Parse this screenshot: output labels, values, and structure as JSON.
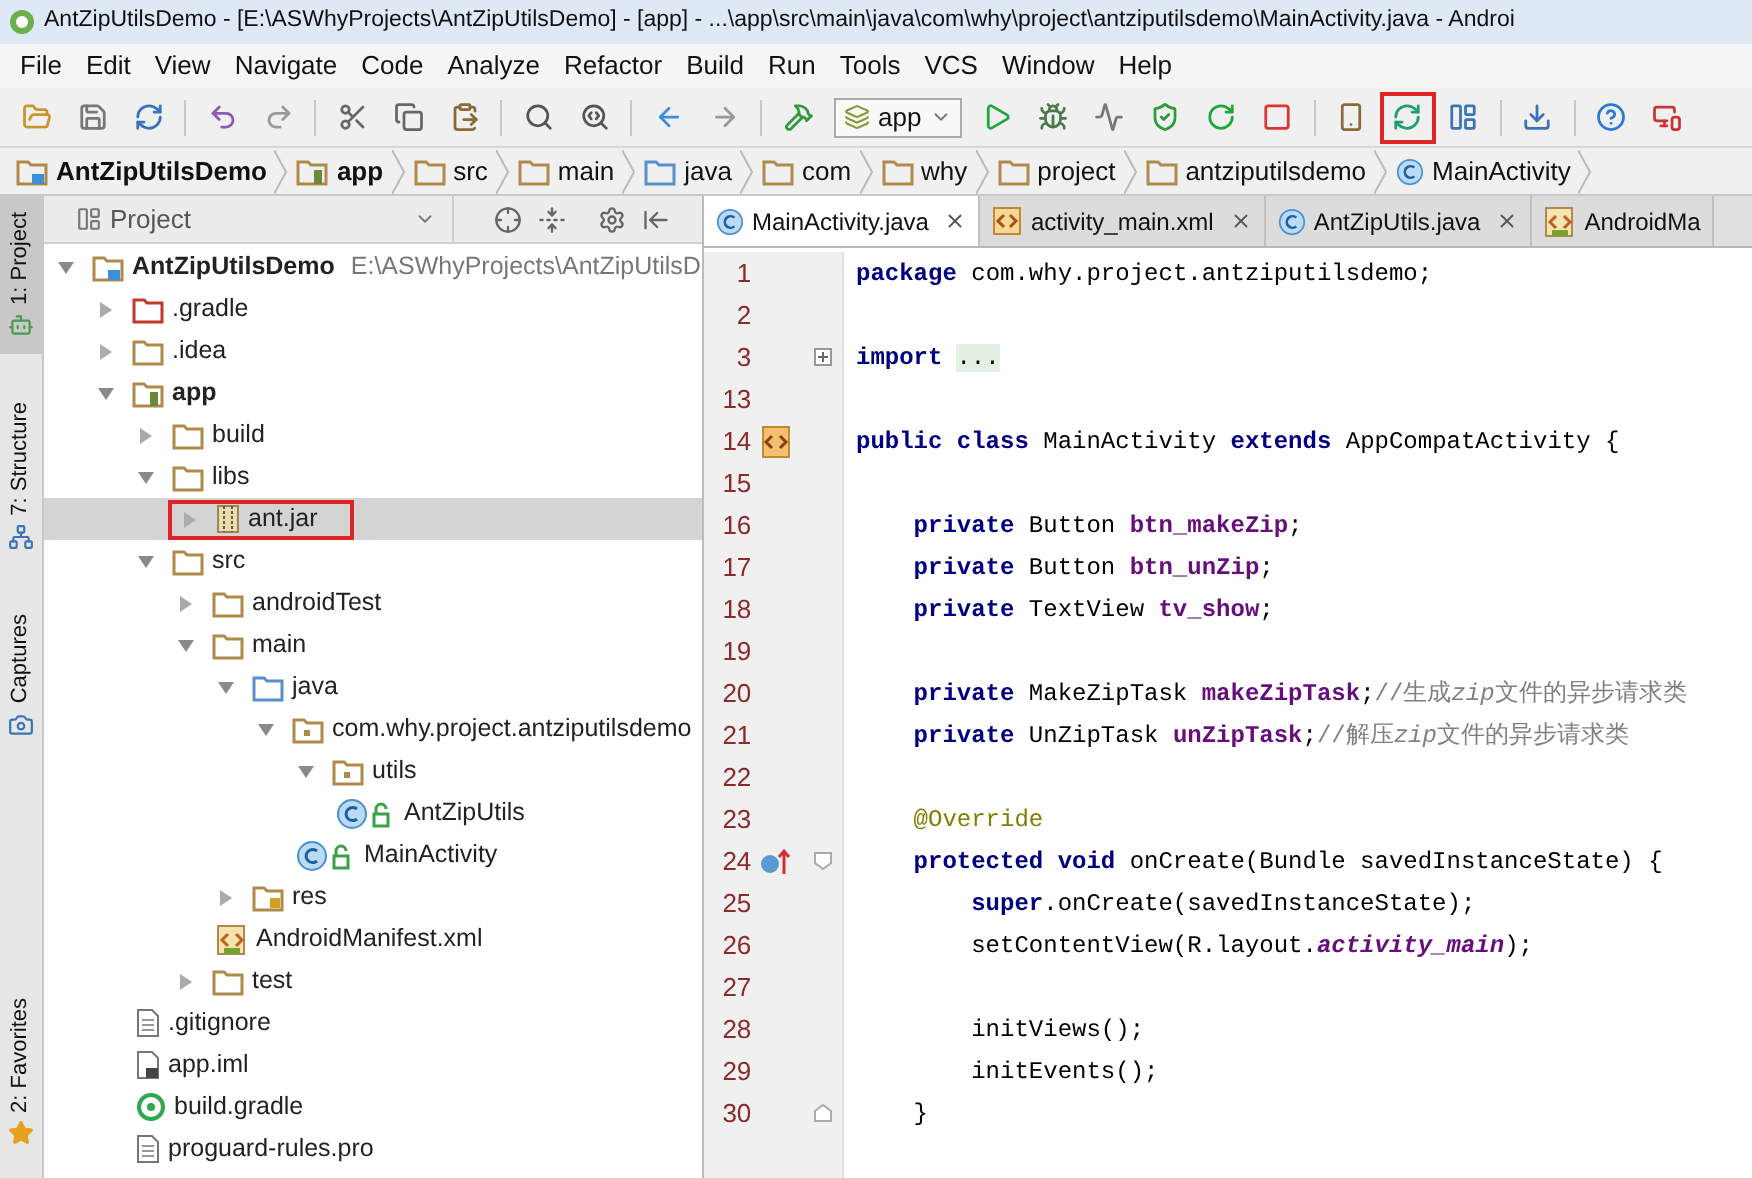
{
  "window": {
    "title": "AntZipUtilsDemo - [E:\\ASWhyProjects\\AntZipUtilsDemo] - [app] - ...\\app\\src\\main\\java\\com\\why\\project\\antziputilsdemo\\MainActivity.java - Androi"
  },
  "menu": [
    "File",
    "Edit",
    "View",
    "Navigate",
    "Code",
    "Analyze",
    "Refactor",
    "Build",
    "Run",
    "Tools",
    "VCS",
    "Window",
    "Help"
  ],
  "toolbar": [
    [
      {
        "kind": "open"
      },
      {
        "kind": "save"
      },
      {
        "kind": "sync"
      }
    ],
    [
      {
        "kind": "undo"
      },
      {
        "kind": "redo"
      }
    ],
    [
      {
        "kind": "cut"
      },
      {
        "kind": "copy"
      },
      {
        "kind": "paste"
      }
    ],
    [
      {
        "kind": "find"
      },
      {
        "kind": "replace"
      }
    ],
    [
      {
        "kind": "back"
      },
      {
        "kind": "forward"
      }
    ],
    [
      {
        "kind": "make"
      },
      {
        "kind": "config",
        "label": "app"
      },
      {
        "kind": "run"
      },
      {
        "kind": "debug"
      },
      {
        "kind": "attach"
      },
      {
        "kind": "coverage"
      },
      {
        "kind": "apply"
      },
      {
        "kind": "stop"
      }
    ],
    [
      {
        "kind": "avd"
      },
      {
        "kind": "gradle",
        "highlighted": true
      },
      {
        "kind": "structure"
      }
    ],
    [
      {
        "kind": "sdk"
      }
    ],
    [
      {
        "kind": "help"
      },
      {
        "kind": "monitor"
      }
    ]
  ],
  "breadcrumbs": [
    {
      "label": "AntZipUtilsDemo",
      "kind": "module"
    },
    {
      "label": "app",
      "kind": "app"
    },
    {
      "label": "src",
      "kind": "folder"
    },
    {
      "label": "main",
      "kind": "folder"
    },
    {
      "label": "java",
      "kind": "source"
    },
    {
      "label": "com",
      "kind": "package"
    },
    {
      "label": "why",
      "kind": "package"
    },
    {
      "label": "project",
      "kind": "package"
    },
    {
      "label": "antziputilsdemo",
      "kind": "package"
    },
    {
      "label": "MainActivity",
      "kind": "class"
    }
  ],
  "tool_strip": [
    {
      "label": "1: Project",
      "selected": true,
      "kind": "project"
    },
    {
      "label": "7: Structure",
      "selected": false,
      "kind": "structure"
    },
    {
      "label": "Captures",
      "selected": false,
      "kind": "captures"
    },
    {
      "label": "2: Favorites",
      "selected": false,
      "kind": "favorites"
    }
  ],
  "project": {
    "view": "Project",
    "tree": [
      {
        "label": "AntZipUtilsDemo",
        "path": "E:\\ASWhyProjects\\AntZipUtilsD",
        "kind": "module",
        "expanded": true,
        "children": [
          {
            "label": ".gradle",
            "kind": "excluded",
            "expanded": false
          },
          {
            "label": ".idea",
            "kind": "folder",
            "expanded": false
          },
          {
            "label": "app",
            "kind": "app",
            "expanded": true,
            "children": [
              {
                "label": "build",
                "kind": "folder",
                "expanded": false
              },
              {
                "label": "libs",
                "kind": "folder",
                "expanded": true,
                "children": [
                  {
                    "label": "ant.jar",
                    "kind": "jar",
                    "expanded": false,
                    "selected": true,
                    "highlighted": true
                  }
                ]
              },
              {
                "label": "src",
                "kind": "folder",
                "expanded": true,
                "children": [
                  {
                    "label": "androidTest",
                    "kind": "folder",
                    "expanded": false
                  },
                  {
                    "label": "main",
                    "kind": "folder",
                    "expanded": true,
                    "children": [
                      {
                        "label": "java",
                        "kind": "source",
                        "expanded": true,
                        "children": [
                          {
                            "label": "com.why.project.antziputilsdemo",
                            "kind": "package",
                            "expanded": true,
                            "children": [
                              {
                                "label": "utils",
                                "kind": "package",
                                "expanded": true,
                                "children": [
                                  {
                                    "label": "AntZipUtils",
                                    "kind": "class"
                                  }
                                ]
                              },
                              {
                                "label": "MainActivity",
                                "kind": "class"
                              }
                            ]
                          }
                        ]
                      },
                      {
                        "label": "res",
                        "kind": "res",
                        "expanded": false
                      },
                      {
                        "label": "AndroidManifest.xml",
                        "kind": "manifest"
                      }
                    ]
                  },
                  {
                    "label": "test",
                    "kind": "folder",
                    "expanded": false
                  }
                ]
              },
              {
                "label": ".gitignore",
                "kind": "file"
              },
              {
                "label": "app.iml",
                "kind": "iml"
              },
              {
                "label": "build.gradle",
                "kind": "gradle"
              },
              {
                "label": "proguard-rules.pro",
                "kind": "file"
              }
            ]
          }
        ]
      }
    ]
  },
  "editor": {
    "tabs": [
      {
        "label": "MainActivity.java",
        "kind": "class",
        "selected": true,
        "closable": true
      },
      {
        "label": "activity_main.xml",
        "kind": "xml",
        "selected": false,
        "closable": true
      },
      {
        "label": "AntZipUtils.java",
        "kind": "class",
        "selected": false,
        "closable": true
      },
      {
        "label": "AndroidMa",
        "kind": "manifest",
        "selected": false,
        "closable": false
      }
    ],
    "lines": [
      {
        "number": "1",
        "tokens": [
          {
            "kind": "keyword",
            "text": "package"
          },
          {
            "kind": "plain",
            "text": " com.why.project.antziputilsdemo;"
          }
        ]
      },
      {
        "number": "2"
      },
      {
        "number": "3",
        "kind": "folded-import",
        "tokens": [
          {
            "kind": "keyword",
            "text": "import"
          },
          {
            "kind": "folded",
            "text": "..."
          }
        ]
      },
      {
        "number": "13"
      },
      {
        "number": "14",
        "kind": "class-declaration",
        "tokens": [
          {
            "kind": "keyword",
            "text": "public class"
          },
          {
            "kind": "plain",
            "text": " MainActivity "
          },
          {
            "kind": "keyword",
            "text": "extends"
          },
          {
            "kind": "plain",
            "text": " AppCompatActivity {"
          }
        ]
      },
      {
        "number": "15"
      },
      {
        "number": "16",
        "tokens": [
          {
            "kind": "keyword",
            "text": "    private"
          },
          {
            "kind": "plain",
            "text": " Button "
          },
          {
            "kind": "field",
            "text": "btn_makeZip"
          },
          {
            "kind": "plain",
            "text": ";"
          }
        ]
      },
      {
        "number": "17",
        "tokens": [
          {
            "kind": "keyword",
            "text": "    private"
          },
          {
            "kind": "plain",
            "text": " Button "
          },
          {
            "kind": "field",
            "text": "btn_unZip"
          },
          {
            "kind": "plain",
            "text": ";"
          }
        ]
      },
      {
        "number": "18",
        "tokens": [
          {
            "kind": "keyword",
            "text": "    private"
          },
          {
            "kind": "plain",
            "text": " TextView "
          },
          {
            "kind": "field",
            "text": "tv_show"
          },
          {
            "kind": "plain",
            "text": ";"
          }
        ]
      },
      {
        "number": "19"
      },
      {
        "number": "20",
        "tokens": [
          {
            "kind": "keyword",
            "text": "    private"
          },
          {
            "kind": "plain",
            "text": " MakeZipTask "
          },
          {
            "kind": "field",
            "text": "makeZipTask"
          },
          {
            "kind": "plain",
            "text": ";"
          },
          {
            "kind": "comment",
            "text": "//生成"
          },
          {
            "kind": "comment-italic",
            "text": "zip"
          },
          {
            "kind": "comment",
            "text": "文件的异步请求类"
          }
        ]
      },
      {
        "number": "21",
        "tokens": [
          {
            "kind": "keyword",
            "text": "    private"
          },
          {
            "kind": "plain",
            "text": " UnZipTask "
          },
          {
            "kind": "field",
            "text": "unZipTask"
          },
          {
            "kind": "plain",
            "text": ";"
          },
          {
            "kind": "comment",
            "text": "//解压"
          },
          {
            "kind": "comment-italic",
            "text": "zip"
          },
          {
            "kind": "comment",
            "text": "文件的异步请求类"
          }
        ]
      },
      {
        "number": "22"
      },
      {
        "number": "23",
        "tokens": [
          {
            "kind": "annotation",
            "text": "    @Override"
          }
        ]
      },
      {
        "number": "24",
        "kind": "override-method",
        "tokens": [
          {
            "kind": "keyword",
            "text": "    protected void"
          },
          {
            "kind": "plain",
            "text": " onCreate(Bundle savedInstanceState) {"
          }
        ]
      },
      {
        "number": "25",
        "tokens": [
          {
            "kind": "keyword",
            "text": "        super"
          },
          {
            "kind": "plain",
            "text": ".onCreate(savedInstanceState);"
          }
        ]
      },
      {
        "number": "26",
        "tokens": [
          {
            "kind": "plain",
            "text": "        setContentView(R.layout."
          },
          {
            "kind": "static",
            "text": "activity_main"
          },
          {
            "kind": "plain",
            "text": ");"
          }
        ]
      },
      {
        "number": "27"
      },
      {
        "number": "28",
        "tokens": [
          {
            "kind": "plain",
            "text": "        initViews();"
          }
        ]
      },
      {
        "number": "29",
        "tokens": [
          {
            "kind": "plain",
            "text": "        initEvents();"
          }
        ]
      },
      {
        "number": "30",
        "kind": "block-end",
        "tokens": [
          {
            "kind": "plain",
            "text": "    }"
          }
        ]
      }
    ]
  }
}
